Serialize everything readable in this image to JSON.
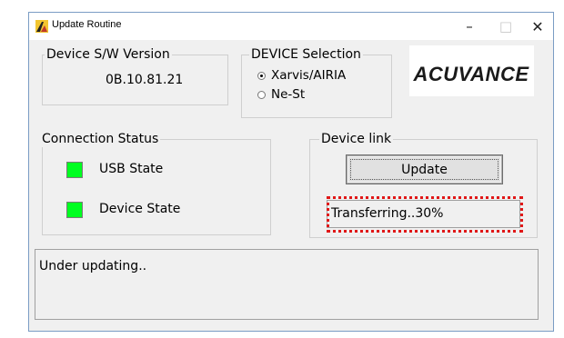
{
  "window": {
    "title": "Update Routine",
    "minimize": "–",
    "maximize": "□",
    "close": "✕"
  },
  "sw_version": {
    "label": "Device S/W Version",
    "value": "0B.10.81.21"
  },
  "device_selection": {
    "label": "DEVICE Selection",
    "options": [
      {
        "label": "Xarvis/AIRIA",
        "selected": true
      },
      {
        "label": "Ne-St",
        "selected": false
      }
    ]
  },
  "logo": {
    "text": "ACUVANCE",
    "color": "#1a1a1a"
  },
  "connection_status": {
    "label": "Connection Status",
    "items": [
      {
        "label": "USB State",
        "color": "#00ff21"
      },
      {
        "label": "Device State",
        "color": "#00ff21"
      }
    ]
  },
  "device_link": {
    "label": "Device link",
    "update_button": "Update",
    "progress_text": "Transferring..30%",
    "highlight_color": "#e01818"
  },
  "status_message": "Under updating.."
}
